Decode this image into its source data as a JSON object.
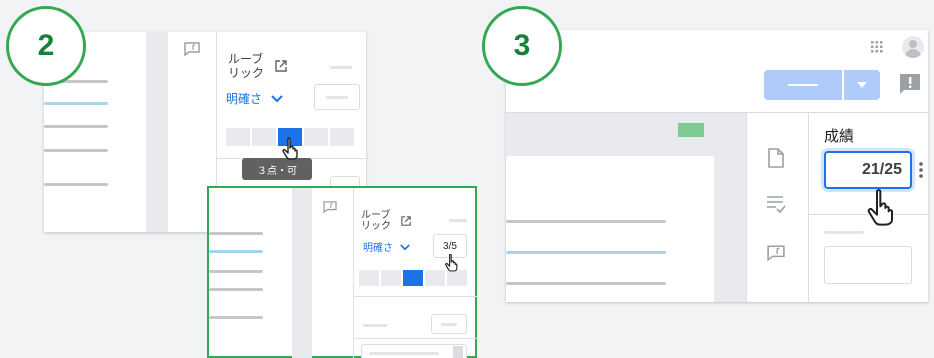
{
  "steps": {
    "two": "2",
    "three": "3"
  },
  "panel2": {
    "rubric_label": "ルーブリック",
    "criterion_label": "明確さ",
    "tooltip": "３点・可"
  },
  "panel2_inset": {
    "rubric_label": "ルーブリック",
    "criterion_label": "明確さ",
    "score_value": "3/5"
  },
  "panel3": {
    "grade_label": "成績",
    "grade_value": "21/25"
  },
  "colors": {
    "accent": "#1a73e8",
    "green": "#34a853",
    "selected_line": "#a7d5ec"
  }
}
